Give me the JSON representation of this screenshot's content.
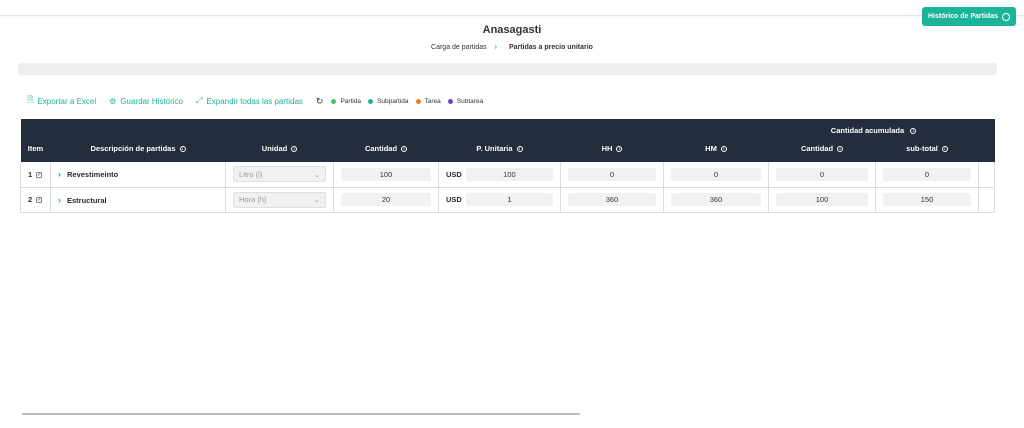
{
  "header": {
    "title": "Anasagasti",
    "history_button": "Histórico de Partidas"
  },
  "breadcrumb": {
    "step1": "Carga de partidas",
    "step2": "Partidas a precio unitario"
  },
  "toolbar": {
    "export": "Exportar a Excel",
    "save_history": "Guardar Histórico",
    "expand": "Expandir todas las partidas"
  },
  "legend": [
    {
      "label": "Partida",
      "color": "#3cc46b"
    },
    {
      "label": "Subpartida",
      "color": "#1bb39b"
    },
    {
      "label": "Tarea",
      "color": "#ef7d22"
    },
    {
      "label": "Subtarea",
      "color": "#7b3fbf"
    }
  ],
  "table": {
    "group_header": "Cantidad acumulada",
    "columns": {
      "item": "Item",
      "desc": "Descripción de partidas",
      "unit": "Unidad",
      "qty": "Cantidad",
      "pu": "P. Unitaria",
      "hh": "HH",
      "hm": "HM",
      "acc_qty": "Cantidad",
      "subtotal": "sub-total"
    },
    "rows": [
      {
        "item": "1",
        "desc": "Revestimeinto",
        "unit": "Litro (l)",
        "qty": "100",
        "currency": "USD",
        "pu": "100",
        "hh": "0",
        "hm": "0",
        "acc_qty": "0",
        "subtotal": "0"
      },
      {
        "item": "2",
        "desc": "Estructural",
        "unit": "Hora (h)",
        "qty": "20",
        "currency": "USD",
        "pu": "1",
        "hh": "360",
        "hm": "360",
        "acc_qty": "100",
        "subtotal": "150"
      }
    ]
  }
}
